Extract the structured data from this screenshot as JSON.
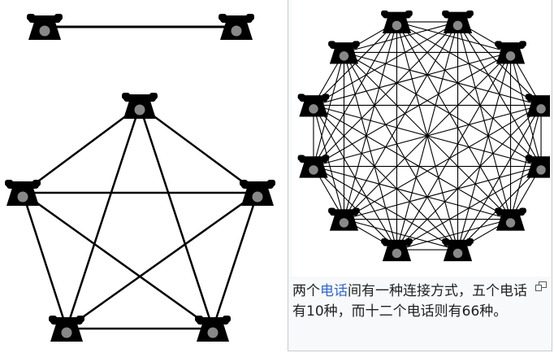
{
  "caption": {
    "prefix": "两个",
    "link": "电话",
    "suffix": "间有一种连接方式，五个电话有10种，而十二个电话则有66种。"
  },
  "icons": {
    "node": "telephone-icon",
    "enlarge": "magnify-clip-icon"
  },
  "colors": {
    "phone": "#000000",
    "dial": "#888888",
    "edge": "#000000",
    "link": "#3366cc",
    "frame_border": "#c8ccd1",
    "frame_bg": "#f8f9fa"
  },
  "graphs": [
    {
      "name": "two-phones",
      "node_count": 2,
      "connection_count": 1
    },
    {
      "name": "five-phones",
      "node_count": 5,
      "connection_count": 10
    },
    {
      "name": "twelve-phones",
      "node_count": 12,
      "connection_count": 66
    }
  ]
}
